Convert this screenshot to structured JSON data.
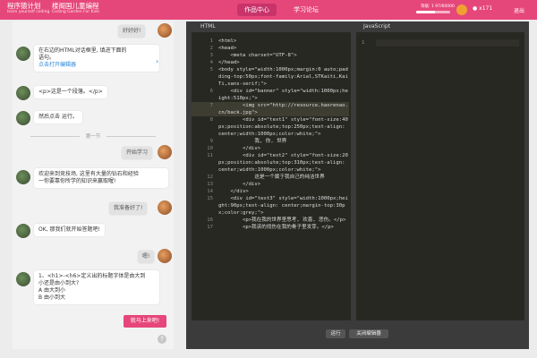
{
  "header": {
    "logo1_title": "程序猿计划",
    "logo1_sub": "learn yourself coding",
    "logo2_title": "楼阁国儿童编程",
    "logo2_sub": "Coding Garden For Kids",
    "nav": [
      "作品中心",
      "学习论坛"
    ],
    "level_label": "等级: 1",
    "points_label": "97/60000",
    "progress": 0.55,
    "coins": "x171",
    "logout": "退出"
  },
  "chat": {
    "msg1": "好好好!",
    "msg2_line1": "在右边的HTML对话框里, 填进下面的",
    "msg2_line2": "语句。",
    "msg2_link": "点击打开编辑器",
    "msg3": "<p>这是一个段落。</p>",
    "msg4": "然后点击 运行。",
    "divider": "第一节",
    "msg5": "开始学习",
    "msg6_line1": "欢迎来到竞技场, 这里有大量的钻石和经验",
    "msg6_line2": "一你要靠你所学的知识来赢取喔!",
    "msg7": "我准备好了!",
    "msg8": "OK, 那我们就开始答题吧!",
    "msg9": "嗯!",
    "msg10_line1": "1、<h1>-<h6>定义出的标题字体是由大到",
    "msg10_line2": "小还是由小到大?",
    "msg10_optA": "A 由大到小",
    "msg10_optB": "B 由小到大",
    "start_button": "就马上来吧!",
    "help": "?"
  },
  "ide": {
    "html_title": "HTML",
    "js_title": "JavaScript",
    "run_button": "运行",
    "close_button": "关闭编辑器",
    "js_line_num": "1"
  },
  "code_lines": [
    {
      "n": "1",
      "t": "<html>"
    },
    {
      "n": "2",
      "t": "<head>"
    },
    {
      "n": "3",
      "t": "    <meta charset=\"UTF-8\">"
    },
    {
      "n": "4",
      "t": "</head>"
    },
    {
      "n": "5",
      "t": "<body style=\"width:1000px;margin:0 auto;padding-top:50px;font-family:Arial,STKaiti,KaiTi,sans-serif;\">"
    },
    {
      "n": "6",
      "t": "    <div id=\"banner\" style=\"width:1000px;height:510px;\">"
    },
    {
      "n": "7",
      "t": "        <img src=\"http://resource.haorenao.cn/back.jpg\">",
      "hl": true
    },
    {
      "n": "8",
      "t": "        <div id=\"text1\" style=\"font-size:40px;position:absolute;top:250px;text-align: center;width:1000px;color:white;\">"
    },
    {
      "n": "9",
      "t": "            我, 你, 世界"
    },
    {
      "n": "10",
      "t": "        </div>"
    },
    {
      "n": "11",
      "t": "        <div id=\"text2\" style=\"font-size:20px;position:absolute;top:310px;text-align: center;width:1000px;color:white;\">"
    },
    {
      "n": "12",
      "t": "            这是一个属于我自己的纯洁世界"
    },
    {
      "n": "13",
      "t": "        </div>"
    },
    {
      "n": "14",
      "t": "    </div>"
    },
    {
      "n": "15",
      "t": "    <div id=\"text3\" style=\"width:1000px;height:90px;text-align: center;margin-top:30px;color:grey;\">"
    },
    {
      "n": "16",
      "t": "        <p>我在我的世界里思考, 欢喜, 悲伤。</p>"
    },
    {
      "n": "17",
      "t": "        <p>我该的找伤在我的骨子里发芽。</p>"
    }
  ]
}
